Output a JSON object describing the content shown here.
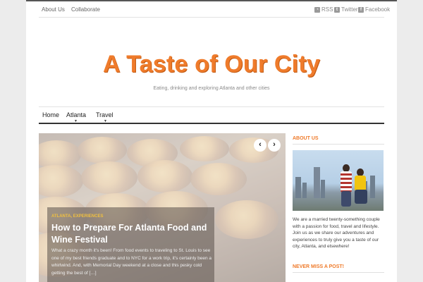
{
  "topbar": {
    "links": [
      "About Us",
      "Collaborate"
    ],
    "social": [
      {
        "label": "RSS",
        "icon": "rss-icon"
      },
      {
        "label": "Twitter",
        "icon": "twitter-icon"
      },
      {
        "label": "Facebook",
        "icon": "facebook-icon"
      }
    ]
  },
  "header": {
    "title": "A Taste of Our City",
    "tagline": "Eating, drinking and exploring Atlanta and other cities"
  },
  "nav": {
    "items": [
      "Home",
      "Atlanta",
      "Travel"
    ]
  },
  "slider": {
    "prev": "‹",
    "next": "›",
    "category": "ATLANTA, EXPERIENCES",
    "post_title": "How to Prepare For Atlanta Food and Wine Festival",
    "excerpt": "What a crazy month it's been! From food events to traveling to St. Louis to see one of my best friends graduate and to NYC for a work trip, it's certainly been a whirlwind. And, with Memorial Day weekend at a close and this pesky cold getting the best of […]"
  },
  "sidebar": {
    "about_heading": "ABOUT US",
    "about_text": "We are a married twenty-something couple with a passion for food, travel and lifestyle. Join us as we share our adventures and experiences to truly give you a taste of our city, Atlanta, and elsewhere!",
    "never_miss_heading": "NEVER MISS A POST!"
  },
  "colors": {
    "accent": "#ef7b2b",
    "nav_border": "#333333",
    "background": "#ececec"
  }
}
